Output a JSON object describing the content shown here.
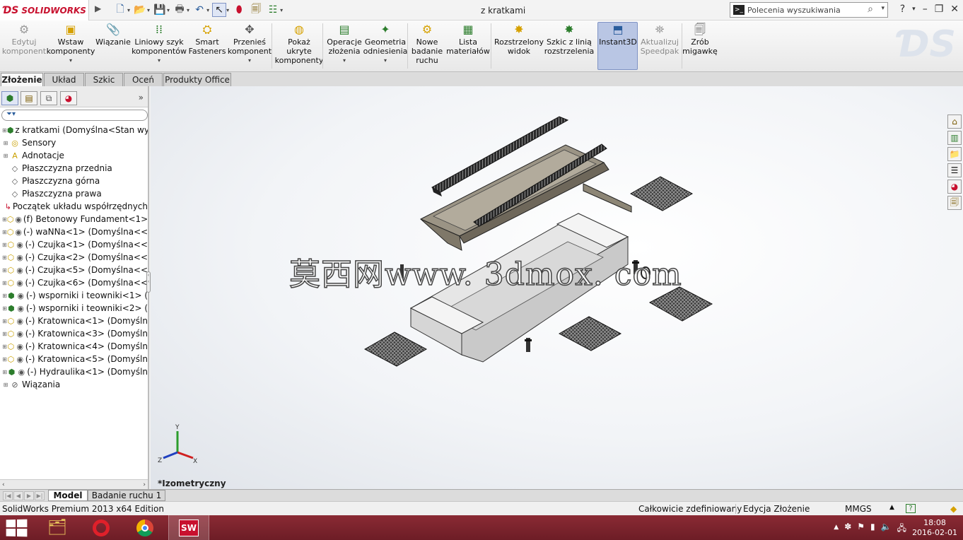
{
  "app": {
    "logo_text": "SOLIDWORKS",
    "document_title": "z kratkami",
    "search_placeholder": "Polecenia wyszukiwania"
  },
  "ribbon": [
    {
      "label": "Edytuj\nkomponent",
      "disabled": true
    },
    {
      "label": "Wstaw\nkomponenty",
      "dropdown": true
    },
    {
      "label": "Wiązanie"
    },
    {
      "label": "Liniowy szyk\nkomponentów",
      "dropdown": true
    },
    {
      "label": "Smart\nFasteners"
    },
    {
      "label": "Przenieś\nkomponent",
      "dropdown": true
    },
    {
      "label": "Pokaż\nukryte\nkomponenty"
    },
    {
      "label": "Operacje\nzłożenia",
      "dropdown": true
    },
    {
      "label": "Geometria\nodniesienia",
      "dropdown": true
    },
    {
      "label": "Nowe\nbadanie\nruchu"
    },
    {
      "label": "Lista\nmateriałów"
    },
    {
      "label": "Rozstrzelony\nwidok"
    },
    {
      "label": "Szkic z linią\nrozstrzelenia"
    },
    {
      "label": "Instant3D",
      "active": true
    },
    {
      "label": "Aktualizuj\nSpeedpak",
      "disabled": true
    },
    {
      "label": "Zrób\nmigawkę"
    }
  ],
  "command_tabs": [
    "Złożenie",
    "Układ",
    "Szkic",
    "Oceń",
    "Produkty Office"
  ],
  "tree": [
    {
      "label": "z kratkami  (Domyślna<Stan wyś",
      "icon": "assembly-icon"
    },
    {
      "label": "Sensory",
      "icon": "sensor-icon"
    },
    {
      "label": "Adnotacje",
      "icon": "annotation-icon"
    },
    {
      "label": "Płaszczyzna przednia",
      "icon": "plane-icon"
    },
    {
      "label": "Płaszczyzna górna",
      "icon": "plane-icon"
    },
    {
      "label": "Płaszczyzna prawa",
      "icon": "plane-icon"
    },
    {
      "label": "Początek układu współrzędnych",
      "icon": "origin-icon"
    },
    {
      "label": "(f) Betonowy Fundament<1> (",
      "icon": "part-icon"
    },
    {
      "label": "(-) waNNa<1> (Domyślna<<",
      "icon": "part-icon"
    },
    {
      "label": "(-) Czujka<1> (Domyślna<<",
      "icon": "part-icon"
    },
    {
      "label": "(-) Czujka<2> (Domyślna<<",
      "icon": "part-icon"
    },
    {
      "label": "(-) Czujka<5> (Domyślna<<",
      "icon": "part-icon"
    },
    {
      "label": "(-) Czujka<6> (Domyślna<<",
      "icon": "part-icon"
    },
    {
      "label": "(-) wsporniki i teowniki<1> (",
      "icon": "subassembly-icon"
    },
    {
      "label": "(-) wsporniki i teowniki<2> (",
      "icon": "subassembly-icon"
    },
    {
      "label": "(-) Kratownica<1> (Domyśln",
      "icon": "part-icon"
    },
    {
      "label": "(-) Kratownica<3> (Domyśln",
      "icon": "part-icon"
    },
    {
      "label": "(-) Kratownica<4> (Domyśln",
      "icon": "part-icon"
    },
    {
      "label": "(-) Kratownica<5> (Domyśln",
      "icon": "part-icon"
    },
    {
      "label": "(-) Hydraulika<1> (Domyśln",
      "icon": "subassembly-icon"
    },
    {
      "label": "Wiązania",
      "icon": "mates-icon"
    }
  ],
  "viewport": {
    "watermark": "莫西网www. 3dmox. com",
    "view_name": "*Izometryczny",
    "axes": [
      "Y",
      "Z",
      "X"
    ]
  },
  "bottom_tabs": [
    "Model",
    "Badanie ruchu 1"
  ],
  "status": {
    "edition": "SolidWorks Premium 2013 x64 Edition",
    "definition": "Całkowicie zdefiniowany",
    "mode": "Edycja Złożenie",
    "units": "MMGS"
  },
  "taskbar": {
    "time": "18:08",
    "date": "2016-02-01"
  },
  "colors": {
    "brand": "#c8102e",
    "taskbar": "#7a2430",
    "active_button": "#b9c6e4"
  }
}
